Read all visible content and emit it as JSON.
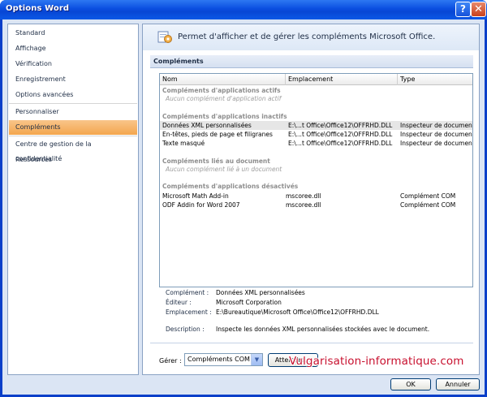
{
  "window": {
    "title": "Options Word",
    "help_glyph": "?",
    "close_glyph": "✕"
  },
  "sidebar": {
    "items": [
      {
        "label": "Standard"
      },
      {
        "label": "Affichage"
      },
      {
        "label": "Vérification"
      },
      {
        "label": "Enregistrement"
      },
      {
        "label": "Options avancées"
      },
      {
        "label": "Personnaliser"
      },
      {
        "label": "Compléments",
        "active": true
      },
      {
        "label": "Centre de gestion de la confidentialité"
      },
      {
        "label": "Ressources"
      }
    ]
  },
  "banner": {
    "text": "Permet d'afficher et de gérer les compléments Microsoft Office.",
    "icon": "addins-gear-icon"
  },
  "section": {
    "title": "Compléments"
  },
  "list": {
    "columns": [
      "Nom",
      "Emplacement",
      "Type"
    ],
    "groups": [
      {
        "title": "Compléments d'applications actifs",
        "empty": "Aucun complément d'application actif",
        "rows": []
      },
      {
        "title": "Compléments d'applications inactifs",
        "empty": "",
        "rows": [
          {
            "name": "Données XML personnalisées",
            "location": "E:\\...t Office\\Office12\\OFFRHD.DLL",
            "type": "Inspecteur de document",
            "selected": true
          },
          {
            "name": "En-têtes, pieds de page et filigranes",
            "location": "E:\\...t Office\\Office12\\OFFRHD.DLL",
            "type": "Inspecteur de document"
          },
          {
            "name": "Texte masqué",
            "location": "E:\\...t Office\\Office12\\OFFRHD.DLL",
            "type": "Inspecteur de document"
          }
        ]
      },
      {
        "title": "Compléments liés au document",
        "empty": "Aucun complément lié à un document",
        "rows": []
      },
      {
        "title": "Compléments d'applications désactivés",
        "empty": "",
        "rows": [
          {
            "name": "Microsoft Math Add-in",
            "location": "mscoree.dll",
            "type": "Complément COM"
          },
          {
            "name": "ODF Addin for Word 2007",
            "location": "mscoree.dll",
            "type": "Complément COM"
          }
        ]
      }
    ]
  },
  "details": {
    "addin_label": "Complément :",
    "addin_value": "Données XML personnalisées",
    "publisher_label": "Éditeur :",
    "publisher_value": "Microsoft Corporation",
    "location_label": "Emplacement :",
    "location_value": "E:\\Bureautique\\Microsoft Office\\Office12\\OFFRHD.DLL",
    "description_label": "Description :",
    "description_value": "Inspecte les données XML personnalisées stockées avec le document."
  },
  "manage": {
    "label": "Gérer :",
    "selected": "Compléments COM",
    "go_button": "Atteindre..."
  },
  "footer": {
    "ok_button": "OK",
    "cancel_button": "Annuler"
  },
  "watermark": "Vulgarisation-informatique.com"
}
